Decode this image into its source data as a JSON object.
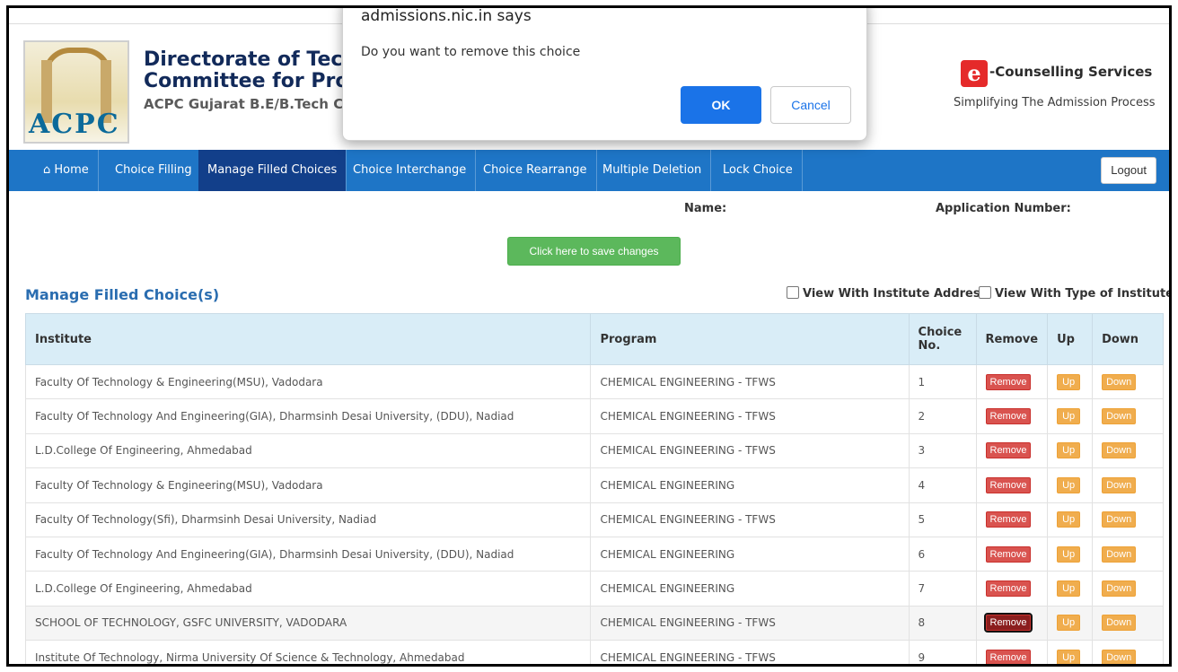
{
  "dialog": {
    "origin": "admissions.nic.in says",
    "message": "Do you want to remove this choice",
    "ok_label": "OK",
    "cancel_label": "Cancel"
  },
  "header": {
    "title_line1": "Directorate of Techni",
    "title_line2": "Committee for Profe",
    "subtitle": "ACPC Gujarat B.E/B.Tech C",
    "logo_text": "ACPC",
    "brand_letter": "e",
    "brand_name": "-Counselling Services",
    "brand_tagline": "Simplifying The Admission Process"
  },
  "nav": {
    "items": [
      {
        "label": "Home",
        "icon": "home-icon"
      },
      {
        "label": "Choice Filling"
      },
      {
        "label": "Manage Filled Choices",
        "active": true
      },
      {
        "label": "Choice Interchange"
      },
      {
        "label": "Choice Rearrange"
      },
      {
        "label": "Multiple Deletion"
      },
      {
        "label": "Lock Choice"
      }
    ],
    "logout_label": "Logout"
  },
  "info": {
    "name_label": "Name:",
    "application_number_label": "Application Number:"
  },
  "save_button_label": "Click here to save changes",
  "section": {
    "title": "Manage Filled Choice(s)",
    "view_address_label": "View With Institute Addres",
    "view_type_label": "View With Type of Institute"
  },
  "table": {
    "headers": {
      "institute": "Institute",
      "program": "Program",
      "choice_no": "Choice No.",
      "remove": "Remove",
      "up": "Up",
      "down": "Down"
    },
    "rows": [
      {
        "institute": "Faculty Of Technology & Engineering(MSU), Vadodara",
        "program": "CHEMICAL ENGINEERING - TFWS",
        "choice_no": "1",
        "remove": "Remove",
        "up": "Up",
        "down": "Down"
      },
      {
        "institute": "Faculty Of Technology And Engineering(GIA), Dharmsinh Desai University, (DDU), Nadiad",
        "program": "CHEMICAL ENGINEERING - TFWS",
        "choice_no": "2",
        "remove": "Remove",
        "up": "Up",
        "down": "Down"
      },
      {
        "institute": "L.D.College Of Engineering, Ahmedabad",
        "program": "CHEMICAL ENGINEERING - TFWS",
        "choice_no": "3",
        "remove": "Remove",
        "up": "Up",
        "down": "Down"
      },
      {
        "institute": "Faculty Of Technology & Engineering(MSU), Vadodara",
        "program": "CHEMICAL ENGINEERING",
        "choice_no": "4",
        "remove": "Remove",
        "up": "Up",
        "down": "Down"
      },
      {
        "institute": "Faculty Of Technology(Sfi), Dharmsinh Desai University, Nadiad",
        "program": "CHEMICAL ENGINEERING - TFWS",
        "choice_no": "5",
        "remove": "Remove",
        "up": "Up",
        "down": "Down"
      },
      {
        "institute": "Faculty Of Technology And Engineering(GIA), Dharmsinh Desai University, (DDU), Nadiad",
        "program": "CHEMICAL ENGINEERING",
        "choice_no": "6",
        "remove": "Remove",
        "up": "Up",
        "down": "Down"
      },
      {
        "institute": "L.D.College Of Engineering, Ahmedabad",
        "program": "CHEMICAL ENGINEERING",
        "choice_no": "7",
        "remove": "Remove",
        "up": "Up",
        "down": "Down"
      },
      {
        "institute": "SCHOOL OF TECHNOLOGY, GSFC UNIVERSITY, VADODARA",
        "program": "CHEMICAL ENGINEERING - TFWS",
        "choice_no": "8",
        "remove": "Remove",
        "up": "Up",
        "down": "Down",
        "highlighted": true
      },
      {
        "institute": "Institute Of Technology, Nirma University Of Science & Technology, Ahmedabad",
        "program": "CHEMICAL ENGINEERING - TFWS",
        "choice_no": "9",
        "remove": "Remove",
        "up": "Up",
        "down": "Down"
      }
    ]
  },
  "colors": {
    "nav_bg": "#1e75c6",
    "nav_active": "#123f8a",
    "remove": "#d9534f",
    "up_down": "#f0ad4e",
    "save": "#5cb85c",
    "dialog_ok": "#1a73e8"
  }
}
